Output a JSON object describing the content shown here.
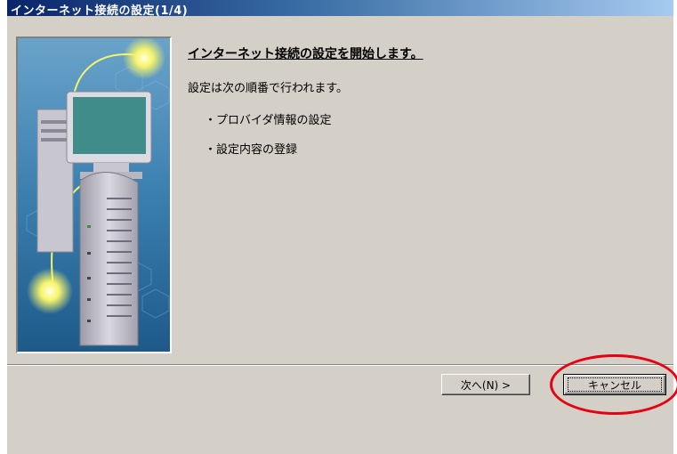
{
  "window": {
    "title": "インターネット接続の設定(1/4)"
  },
  "content": {
    "heading": "インターネット接続の設定を開始します。",
    "intro": "設定は次の順番で行われます。",
    "steps": [
      "・プロバイダ情報の設定",
      "・設定内容の登録"
    ]
  },
  "buttons": {
    "next": "次へ(N) >",
    "cancel": "キャンセル"
  },
  "colors": {
    "highlight": "#e60012",
    "titlebar": "#0a246a",
    "dialog": "#d4d0c8"
  },
  "illustration": {
    "icons": [
      "computer-monitor-icon",
      "router-device-icon",
      "glow-orb-icon"
    ]
  }
}
